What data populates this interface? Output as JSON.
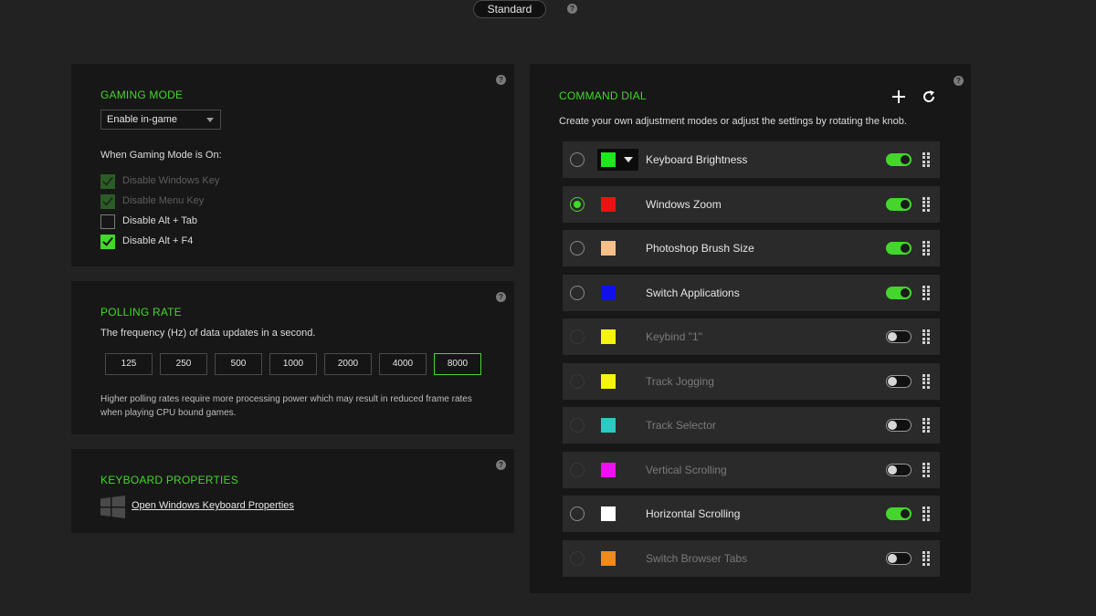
{
  "top": {
    "mode_label": "Standard",
    "help": "?"
  },
  "gaming_mode": {
    "title": "GAMING MODE",
    "select_value": "Enable in-game",
    "when_on_label": "When Gaming Mode is On:",
    "options": [
      {
        "label": "Disable Windows Key",
        "checked": true,
        "disabled": true
      },
      {
        "label": "Disable Menu Key",
        "checked": true,
        "disabled": true
      },
      {
        "label": "Disable Alt + Tab",
        "checked": false,
        "disabled": false
      },
      {
        "label": "Disable Alt + F4",
        "checked": true,
        "disabled": false
      }
    ]
  },
  "polling_rate": {
    "title": "POLLING RATE",
    "description": "The frequency (Hz) of data updates in a second.",
    "rates": [
      "125",
      "250",
      "500",
      "1000",
      "2000",
      "4000",
      "8000"
    ],
    "selected": "8000",
    "note": "Higher polling rates require more processing power which may result in reduced frame rates when playing CPU bound games."
  },
  "keyboard_properties": {
    "title": "KEYBOARD PROPERTIES",
    "link_label": "Open Windows Keyboard Properties"
  },
  "command_dial": {
    "title": "COMMAND DIAL",
    "description": "Create your own adjustment modes or adjust the settings by rotating the knob.",
    "items": [
      {
        "label": "Keyboard Brightness",
        "color": "#1ee81e",
        "enabled": true,
        "selected": false,
        "dropdown": true
      },
      {
        "label": "Windows Zoom",
        "color": "#ee1111",
        "enabled": true,
        "selected": true
      },
      {
        "label": "Photoshop Brush Size",
        "color": "#f5c08a",
        "enabled": true,
        "selected": false
      },
      {
        "label": "Switch Applications",
        "color": "#1010ee",
        "enabled": true,
        "selected": false
      },
      {
        "label": "Keybind \"1\"",
        "color": "#f5f50a",
        "enabled": false,
        "selected": false
      },
      {
        "label": "Track Jogging",
        "color": "#f5f50a",
        "enabled": false,
        "selected": false
      },
      {
        "label": "Track Selector",
        "color": "#2ec9c4",
        "enabled": false,
        "selected": false
      },
      {
        "label": "Vertical Scrolling",
        "color": "#ee10ee",
        "enabled": false,
        "selected": false
      },
      {
        "label": "Horizontal Scrolling",
        "color": "#ffffff",
        "enabled": true,
        "selected": false
      },
      {
        "label": "Switch Browser Tabs",
        "color": "#f0891e",
        "enabled": false,
        "selected": false
      }
    ]
  },
  "colors": {
    "accent": "#44d62c",
    "panel": "#171717",
    "background": "#222222",
    "row": "#2a2a2a"
  },
  "icons": [
    "help-icon",
    "plus-icon",
    "refresh-icon",
    "windows-logo-icon",
    "drag-handle-icon",
    "chevron-down-icon"
  ]
}
